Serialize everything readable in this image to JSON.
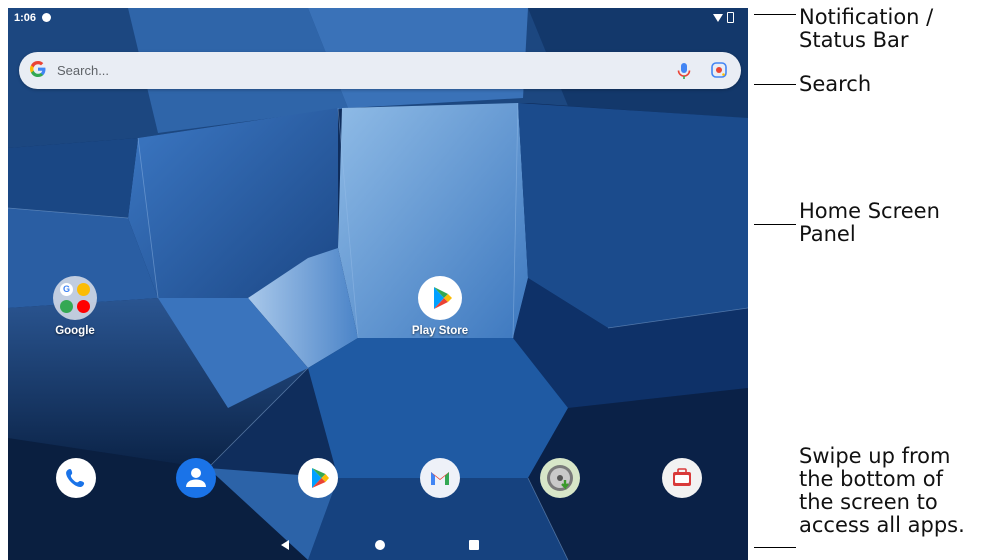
{
  "status_bar": {
    "time": "1:06"
  },
  "search": {
    "placeholder": "Search..."
  },
  "home_apps": [
    {
      "label": "Google",
      "icon": "google-folder-icon"
    },
    {
      "label": "Play Store",
      "icon": "play-store-icon"
    }
  ],
  "dock": [
    {
      "icon": "phone-icon"
    },
    {
      "icon": "contacts-icon"
    },
    {
      "icon": "play-store-icon"
    },
    {
      "icon": "gmail-icon"
    },
    {
      "icon": "update-app-icon"
    },
    {
      "icon": "toolbox-app-icon"
    }
  ],
  "nav": [
    "back-icon",
    "home-icon",
    "recents-icon"
  ],
  "callouts": {
    "status_bar": "Notification /\nStatus Bar",
    "search": "Search",
    "home_panel": "Home Screen\nPanel",
    "swipe": "Swipe up from\nthe bottom of\nthe screen to\naccess all apps."
  },
  "colors": {
    "sky": "#6a9fd6",
    "glass_dark": "#0d2a55",
    "search_bg": "#e9edf4",
    "google_blue": "#4285f4"
  }
}
